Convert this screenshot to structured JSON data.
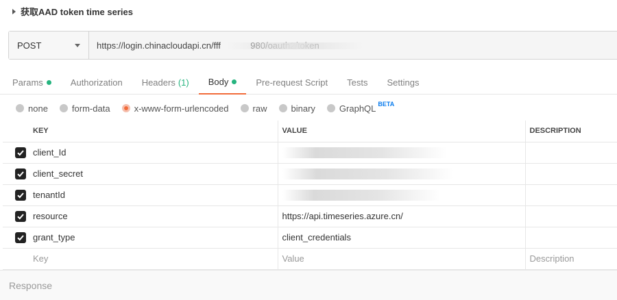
{
  "request": {
    "title": "获取AAD token time series"
  },
  "url_bar": {
    "method": "POST",
    "url": "https://login.chinacloudapi.cn/fff            980/oauth2/token"
  },
  "tabs": [
    {
      "label": "Params",
      "indicator": "dot"
    },
    {
      "label": "Authorization"
    },
    {
      "label": "Headers",
      "count": "(1)"
    },
    {
      "label": "Body",
      "indicator": "dot",
      "active": true
    },
    {
      "label": "Pre-request Script"
    },
    {
      "label": "Tests"
    },
    {
      "label": "Settings"
    }
  ],
  "body_types": {
    "options": [
      "none",
      "form-data",
      "x-www-form-urlencoded",
      "raw",
      "binary",
      "GraphQL"
    ],
    "selected": "x-www-form-urlencoded",
    "graphql_badge": "BETA"
  },
  "table": {
    "headers": {
      "key": "KEY",
      "value": "VALUE",
      "description": "DESCRIPTION"
    },
    "rows": [
      {
        "key": "client_Id",
        "value": "",
        "checked": true
      },
      {
        "key": "client_secret",
        "value": "",
        "checked": true
      },
      {
        "key": "tenantId",
        "value": "",
        "checked": true
      },
      {
        "key": "resource",
        "value": "https://api.timeseries.azure.cn/",
        "checked": true
      },
      {
        "key": "grant_type",
        "value": "client_credentials",
        "checked": true
      }
    ],
    "placeholders": {
      "key": "Key",
      "value": "Value",
      "description": "Description"
    }
  },
  "response": {
    "label": "Response"
  },
  "colors": {
    "accent": "#f26b3a",
    "green": "#26b47f",
    "beta": "#097bed"
  }
}
